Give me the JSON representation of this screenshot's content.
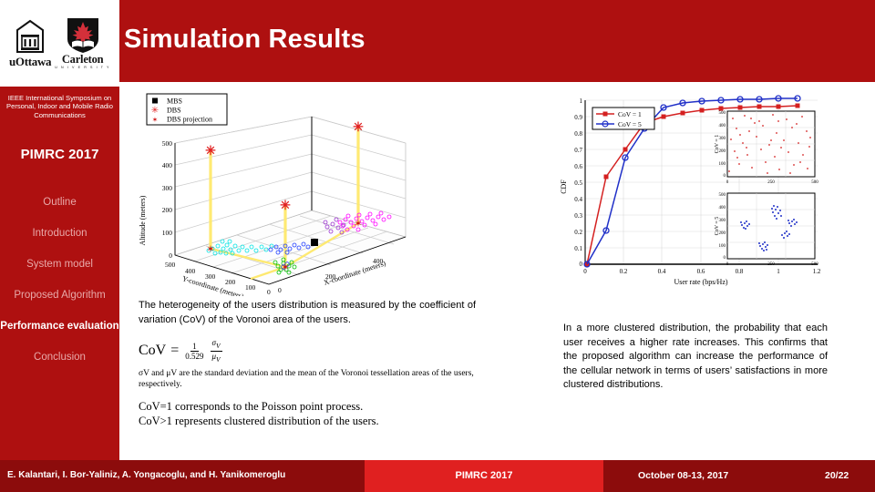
{
  "header": {
    "title": "Simulation Results",
    "logos": [
      {
        "name": "uottawa-logo",
        "caption": "uOttawa"
      },
      {
        "name": "carleton-logo",
        "caption": "Carleton",
        "subcaption": "U N I V E R S I T Y"
      }
    ]
  },
  "sidebar": {
    "conference_full": "IEEE International Symposium on Personal, Indoor and Mobile Radio Communications",
    "conference_tag": "PIMRC 2017",
    "items": [
      {
        "label": "Outline",
        "active": false
      },
      {
        "label": "Introduction",
        "active": false
      },
      {
        "label": "System model",
        "active": false
      },
      {
        "label": "Proposed Algorithm",
        "active": false
      },
      {
        "label": "Performance evaluation",
        "active": true
      },
      {
        "label": "Conclusion",
        "active": false
      }
    ]
  },
  "body": {
    "left_paragraph": "The heterogeneity of the users distribution is measured by the coefficient of variation (CoV) of the Voronoi area of the users.",
    "formula": {
      "lhs": "CoV",
      "equals": "=",
      "frac_num": "1",
      "frac_den": "0.529",
      "ratio_num": "σ",
      "ratio_num_sub": "V",
      "ratio_den": "μ",
      "ratio_den_sub": "V",
      "note": "σV and μV are the standard deviation and the mean of the Voronoi tessellation areas of the users, respectively.",
      "line1": "CoV=1 corresponds to the Poisson point process.",
      "line2": "CoV>1 represents clustered distribution of the users."
    },
    "right_paragraph": "In a more clustered distribution, the probability that each user receives a higher rate increases. This confirms that the proposed algorithm can increase the performance of the cellular network in terms of users’ satisfactions in more clustered distributions."
  },
  "footer": {
    "authors": "E. Kalantari, I. Bor-Yaliniz, A. Yongacoglu, and H. Yanikomeroglu",
    "conference": "PIMRC 2017",
    "date": "October 08-13, 2017",
    "page": "20/22"
  },
  "chart_data": [
    {
      "type": "scatter",
      "name": "deployment-3d-scatter",
      "title": "",
      "xlabel": "X-coordinate (meters)",
      "ylabel": "Y-coordinate (meters)",
      "zlabel": "Altitude (meters)",
      "zticks": [
        0,
        100,
        200,
        300,
        400,
        500
      ],
      "yticks": [
        0,
        100,
        200,
        300,
        400,
        500
      ],
      "xticks": [
        0,
        200,
        400
      ],
      "legend": [
        {
          "label": "MBS",
          "marker": "filled-square",
          "color": "#000000"
        },
        {
          "label": "DBS",
          "marker": "asterisk",
          "color": "#E02020"
        },
        {
          "label": "DBS projection",
          "marker": "hexagram",
          "color": "#D01818"
        }
      ],
      "legend_position": "top-left",
      "grid": true,
      "mbs": [
        {
          "x": 230,
          "y": 170,
          "z": 0
        }
      ],
      "dbs": [
        {
          "x": 95,
          "y": 400,
          "z": 500
        },
        {
          "x": 330,
          "y": 60,
          "z": 500
        },
        {
          "x": 215,
          "y": 210,
          "z": 200
        }
      ],
      "dbs_projection": [
        {
          "x": 95,
          "y": 400,
          "z": 0
        },
        {
          "x": 330,
          "y": 60,
          "z": 0
        },
        {
          "x": 215,
          "y": 210,
          "z": 0
        }
      ],
      "user_clusters": [
        {
          "color": "#00E5E5",
          "cx": 105,
          "cy": 395,
          "n": 38
        },
        {
          "color": "#1E3CFF",
          "cx": 165,
          "cy": 355,
          "n": 22
        },
        {
          "color": "#FF00FF",
          "cx": 345,
          "cy": 110,
          "n": 40
        },
        {
          "color": "#9B30D0",
          "cx": 300,
          "cy": 150,
          "n": 28
        },
        {
          "color": "#00C000",
          "cx": 235,
          "cy": 40,
          "n": 30
        }
      ]
    },
    {
      "type": "line",
      "name": "user-rate-cdf",
      "title": "",
      "xlabel": "User rate (bps/Hz)",
      "ylabel": "CDF",
      "xlim": [
        0,
        1.2
      ],
      "ylim": [
        0,
        1
      ],
      "xticks": [
        0,
        0.2,
        0.4,
        0.6,
        0.8,
        1,
        1.2
      ],
      "yticks": [
        0,
        0.1,
        0.2,
        0.3,
        0.4,
        0.5,
        0.6,
        0.7,
        0.8,
        0.9,
        1
      ],
      "grid": true,
      "legend_position": "top-left",
      "x": [
        0.01,
        0.11,
        0.21,
        0.31,
        0.41,
        0.51,
        0.61,
        0.71,
        0.81,
        0.91,
        1.01,
        1.11
      ],
      "series": [
        {
          "name": "CoV = 1",
          "color": "#D42020",
          "marker": "filled-square",
          "values": [
            0.0,
            0.53,
            0.7,
            0.86,
            0.9,
            0.92,
            0.94,
            0.95,
            0.955,
            0.96,
            0.965,
            0.97
          ]
        },
        {
          "name": "CoV = 5",
          "color": "#2030C8",
          "marker": "open-circle",
          "values": [
            0.0,
            0.24,
            0.65,
            0.83,
            0.94,
            0.96,
            0.97,
            0.975,
            0.98,
            0.982,
            0.985,
            0.985
          ]
        }
      ],
      "insets": [
        {
          "name": "cov1-user-locations",
          "ylabel": "CoV = 1",
          "xticks": [
            0,
            250,
            500
          ],
          "yticks": [
            0,
            100,
            200,
            300,
            400,
            500
          ],
          "color": "#D42020",
          "pattern": "uniform-random",
          "n_points": 130
        },
        {
          "name": "cov5-user-locations",
          "ylabel": "CoV = 5",
          "xticks": [
            0,
            250,
            500
          ],
          "yticks": [
            0,
            100,
            200,
            300,
            400,
            500
          ],
          "color": "#2030C8",
          "pattern": "clustered",
          "n_points": 130,
          "clusters": [
            {
              "cx": 120,
              "cy": 300,
              "n": 22
            },
            {
              "cx": 300,
              "cy": 380,
              "n": 30
            },
            {
              "cx": 370,
              "cy": 290,
              "n": 22
            },
            {
              "cx": 330,
              "cy": 190,
              "n": 22
            },
            {
              "cx": 215,
              "cy": 95,
              "n": 28
            }
          ]
        }
      ]
    }
  ]
}
